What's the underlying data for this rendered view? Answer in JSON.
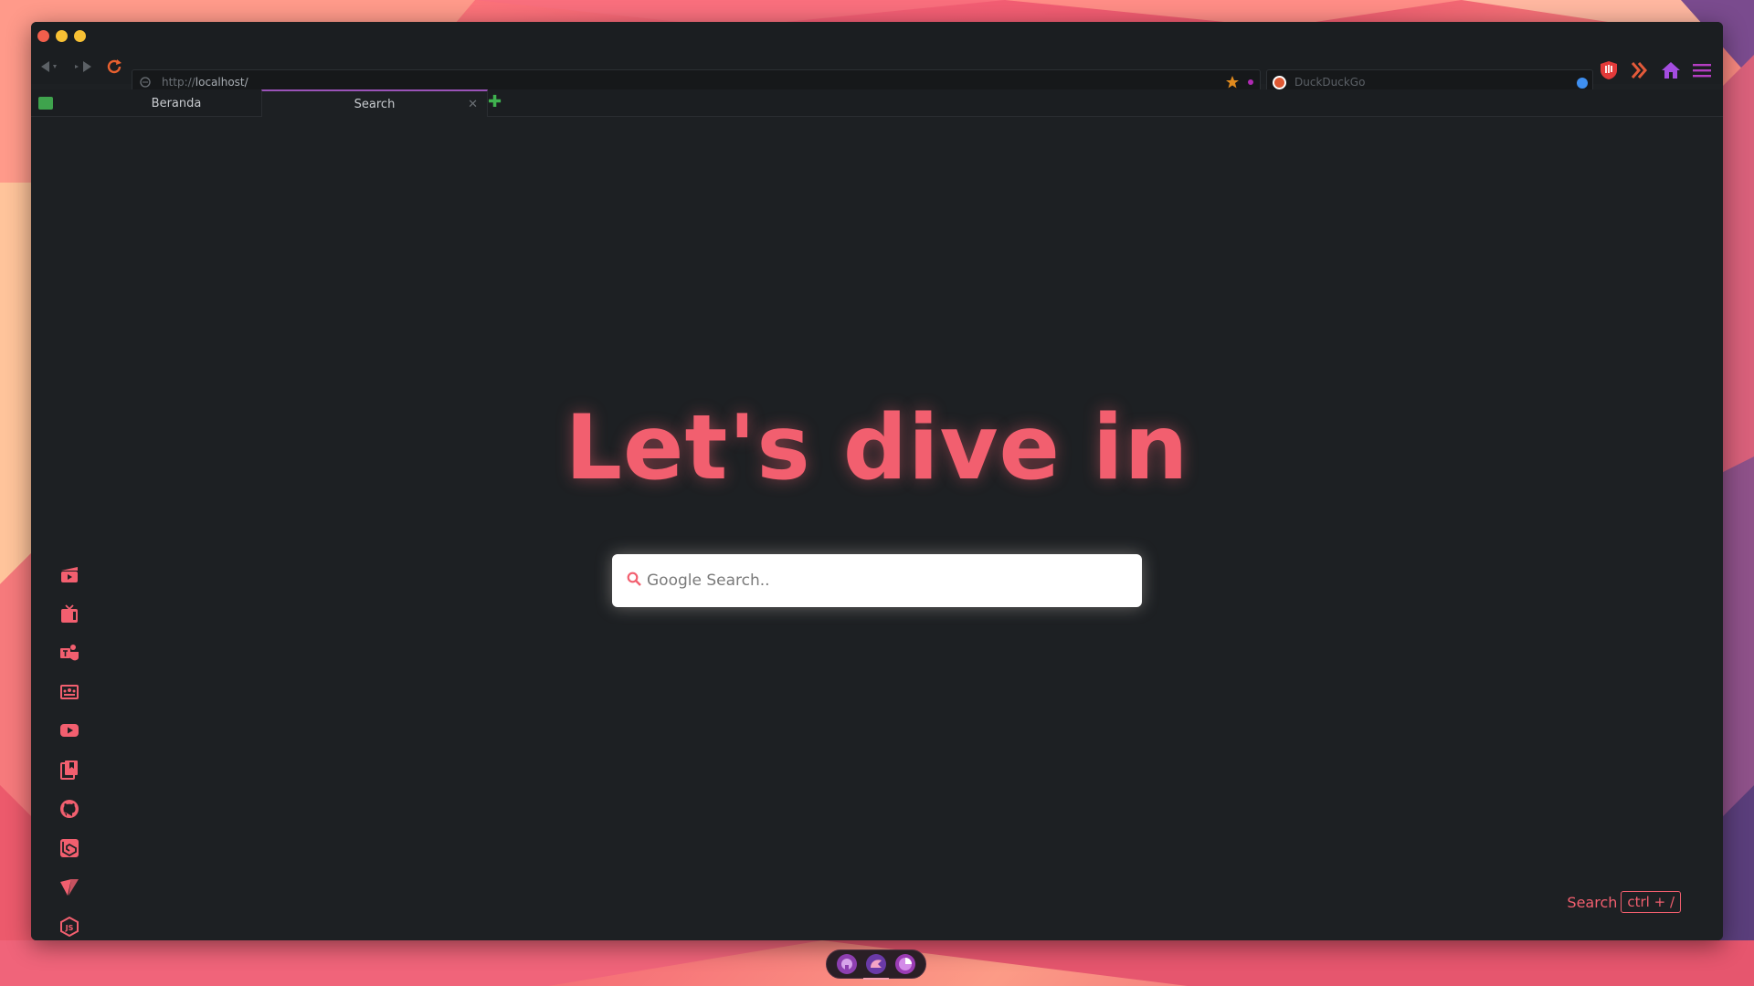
{
  "browser": {
    "url_scheme": "http://",
    "url_host": "localhost/",
    "search_engine_placeholder": "DuckDuckGo"
  },
  "tabs": [
    {
      "label": "Beranda",
      "active": false
    },
    {
      "label": "Search",
      "active": true
    }
  ],
  "page": {
    "heading": "Let's dive in",
    "search_placeholder": "Google Search..",
    "shortcut_label": "Search",
    "shortcut_key": "ctrl + /"
  },
  "sidebar": {
    "items": [
      {
        "icon": "clapperboard-icon"
      },
      {
        "icon": "tv-icon"
      },
      {
        "icon": "teams-icon"
      },
      {
        "icon": "classroom-icon"
      },
      {
        "icon": "youtube-icon"
      },
      {
        "icon": "bookmark-book-icon"
      },
      {
        "icon": "github-icon"
      },
      {
        "icon": "laravel-icon"
      },
      {
        "icon": "vuetify-icon"
      },
      {
        "icon": "nodejs-icon"
      }
    ]
  },
  "dock": {
    "items": [
      {
        "icon": "github-dock-icon"
      },
      {
        "icon": "spartan-dock-icon"
      },
      {
        "icon": "pie-dock-icon"
      }
    ]
  },
  "colors": {
    "accent": "#f25f6f",
    "window_bg": "#1d2023",
    "tab_active_border": "#9a53b8"
  }
}
